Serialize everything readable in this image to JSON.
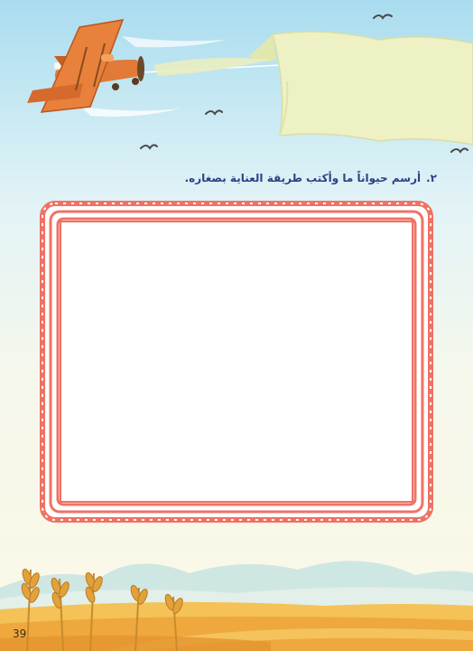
{
  "instruction": {
    "number": "٢.",
    "text": "أرسم حيواناً ما وأكتب طريقة العناية بصغاره."
  },
  "page": {
    "number": "39"
  },
  "colors": {
    "frame": "#ef7264",
    "banner": "#eef1c4",
    "plane": "#e07a36",
    "field": "#f3b84b",
    "mountains": "#bfe0df"
  },
  "icons": [
    "biplane-icon",
    "banner-icon",
    "bird-icon",
    "wheat-icon"
  ]
}
